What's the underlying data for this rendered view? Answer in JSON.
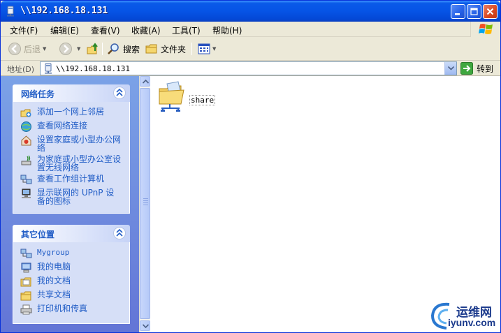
{
  "window": {
    "title": "\\\\192.168.18.131"
  },
  "menu": {
    "items": [
      "文件(F)",
      "编辑(E)",
      "查看(V)",
      "收藏(A)",
      "工具(T)",
      "帮助(H)"
    ]
  },
  "toolbar": {
    "back_label": "后退",
    "search_label": "搜索",
    "folders_label": "文件夹"
  },
  "address": {
    "label": "地址(D)",
    "value": "\\\\192.168.18.131",
    "go_label": "转到"
  },
  "network_tasks": {
    "title": "网络任务",
    "items": [
      {
        "label": "添加一个网上邻居",
        "icon": "add-network-place-icon"
      },
      {
        "label": "查看网络连接",
        "icon": "network-connections-icon"
      },
      {
        "label": "设置家庭或小型办公网络",
        "icon": "home-network-setup-icon"
      },
      {
        "label": "为家庭或小型办公室设置无线网络",
        "icon": "wireless-network-icon"
      },
      {
        "label": "查看工作组计算机",
        "icon": "workgroup-computers-icon"
      },
      {
        "label": "显示联网的 UPnP 设备的图标",
        "icon": "upnp-device-icon"
      }
    ]
  },
  "other_places": {
    "title": "其它位置",
    "items": [
      {
        "label": "Mygroup",
        "icon": "workgroup-icon"
      },
      {
        "label": "我的电脑",
        "icon": "my-computer-icon"
      },
      {
        "label": "我的文档",
        "icon": "my-documents-icon"
      },
      {
        "label": "共享文档",
        "icon": "shared-documents-icon"
      },
      {
        "label": "打印机和传真",
        "icon": "printers-faxes-icon"
      }
    ]
  },
  "content": {
    "items": [
      {
        "label": "share",
        "icon": "shared-folder-icon"
      }
    ]
  },
  "watermark": {
    "line1": "运维网",
    "line2": "iyunv.com"
  },
  "colors": {
    "titlebar": "#0654e6",
    "taskpane": "#7ba2e7",
    "link": "#215dc6"
  }
}
